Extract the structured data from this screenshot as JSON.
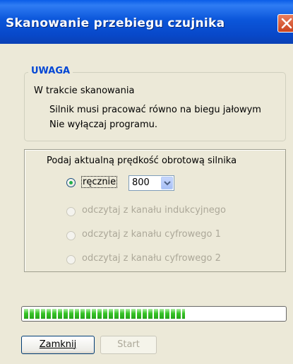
{
  "window": {
    "title": "Skanowanie przebiegu czujnika"
  },
  "notice": {
    "heading": "UWAGA",
    "line1": "W trakcie skanowania",
    "line2": "Silnik musi pracować równo na biegu jałowym",
    "line3": "Nie wyłączaj programu."
  },
  "speed": {
    "heading": "Podaj aktualną prędkość obrotową silnika",
    "options": [
      {
        "label": "ręcznie",
        "selected": true,
        "enabled": true
      },
      {
        "label": "odczytaj z kanału indukcyjnego",
        "selected": false,
        "enabled": false
      },
      {
        "label": "odczytaj z kanału cyfrowego 1",
        "selected": false,
        "enabled": false
      },
      {
        "label": "odczytaj z kanału cyfrowego 2",
        "selected": false,
        "enabled": false
      }
    ],
    "rpm_value": "800"
  },
  "progress": {
    "fraction": 0.62
  },
  "buttons": {
    "close": "Zamknij",
    "start": "Start"
  },
  "colors": {
    "accent": "#0046D5",
    "title_bar": "#0A52D8",
    "progress_fill": "#37C427",
    "disabled_text": "#ACA899"
  }
}
